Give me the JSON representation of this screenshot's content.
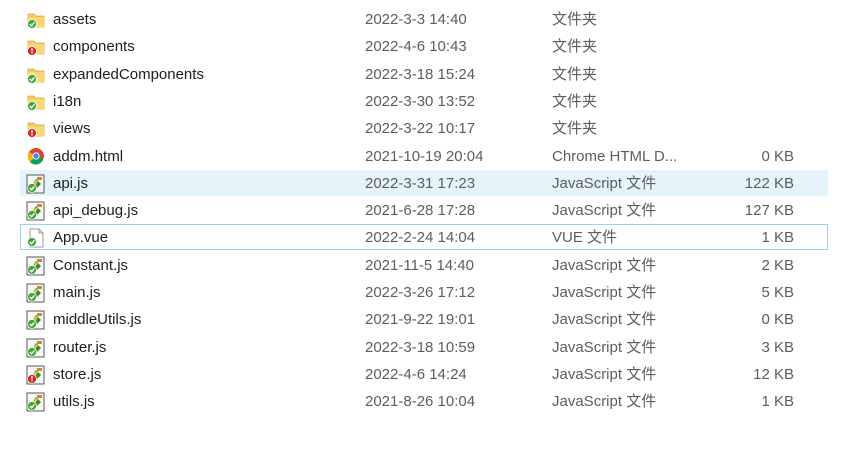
{
  "files": [
    {
      "name": "assets",
      "date": "2022-3-3 14:40",
      "type": "文件夹",
      "size": "",
      "icon": "folder-ok-icon"
    },
    {
      "name": "components",
      "date": "2022-4-6 10:43",
      "type": "文件夹",
      "size": "",
      "icon": "folder-conflict-icon"
    },
    {
      "name": "expandedComponents",
      "date": "2022-3-18 15:24",
      "type": "文件夹",
      "size": "",
      "icon": "folder-ok-icon"
    },
    {
      "name": "i18n",
      "date": "2022-3-30 13:52",
      "type": "文件夹",
      "size": "",
      "icon": "folder-ok-icon"
    },
    {
      "name": "views",
      "date": "2022-3-22 10:17",
      "type": "文件夹",
      "size": "",
      "icon": "folder-conflict-icon"
    },
    {
      "name": "addm.html",
      "date": "2021-10-19 20:04",
      "type": "Chrome HTML D...",
      "size": "0 KB",
      "icon": "chrome-html-icon"
    },
    {
      "name": "api.js",
      "date": "2022-3-31 17:23",
      "type": "JavaScript 文件",
      "size": "122 KB",
      "icon": "js-file-ok-icon"
    },
    {
      "name": "api_debug.js",
      "date": "2021-6-28 17:28",
      "type": "JavaScript 文件",
      "size": "127 KB",
      "icon": "js-file-ok-icon"
    },
    {
      "name": "App.vue",
      "date": "2022-2-24 14:04",
      "type": "VUE 文件",
      "size": "1 KB",
      "icon": "vue-file-ok-icon"
    },
    {
      "name": "Constant.js",
      "date": "2021-11-5 14:40",
      "type": "JavaScript 文件",
      "size": "2 KB",
      "icon": "js-file-ok-icon"
    },
    {
      "name": "main.js",
      "date": "2022-3-26 17:12",
      "type": "JavaScript 文件",
      "size": "5 KB",
      "icon": "js-file-ok-icon"
    },
    {
      "name": "middleUtils.js",
      "date": "2021-9-22 19:01",
      "type": "JavaScript 文件",
      "size": "0 KB",
      "icon": "js-file-ok-icon"
    },
    {
      "name": "router.js",
      "date": "2022-3-18 10:59",
      "type": "JavaScript 文件",
      "size": "3 KB",
      "icon": "js-file-ok-icon"
    },
    {
      "name": "store.js",
      "date": "2022-4-6 14:24",
      "type": "JavaScript 文件",
      "size": "12 KB",
      "icon": "js-file-conflict-icon"
    },
    {
      "name": "utils.js",
      "date": "2021-8-26 10:04",
      "type": "JavaScript 文件",
      "size": "1 KB",
      "icon": "js-file-ok-icon"
    }
  ],
  "hovered_row": "api.js",
  "focused_row": "App.vue",
  "colors": {
    "hover_bg": "#e5f3fb",
    "focus_border": "#99d1f0",
    "folder": "#f4c95d",
    "status_ok": "#3fa535",
    "status_conflict": "#d9261c"
  }
}
